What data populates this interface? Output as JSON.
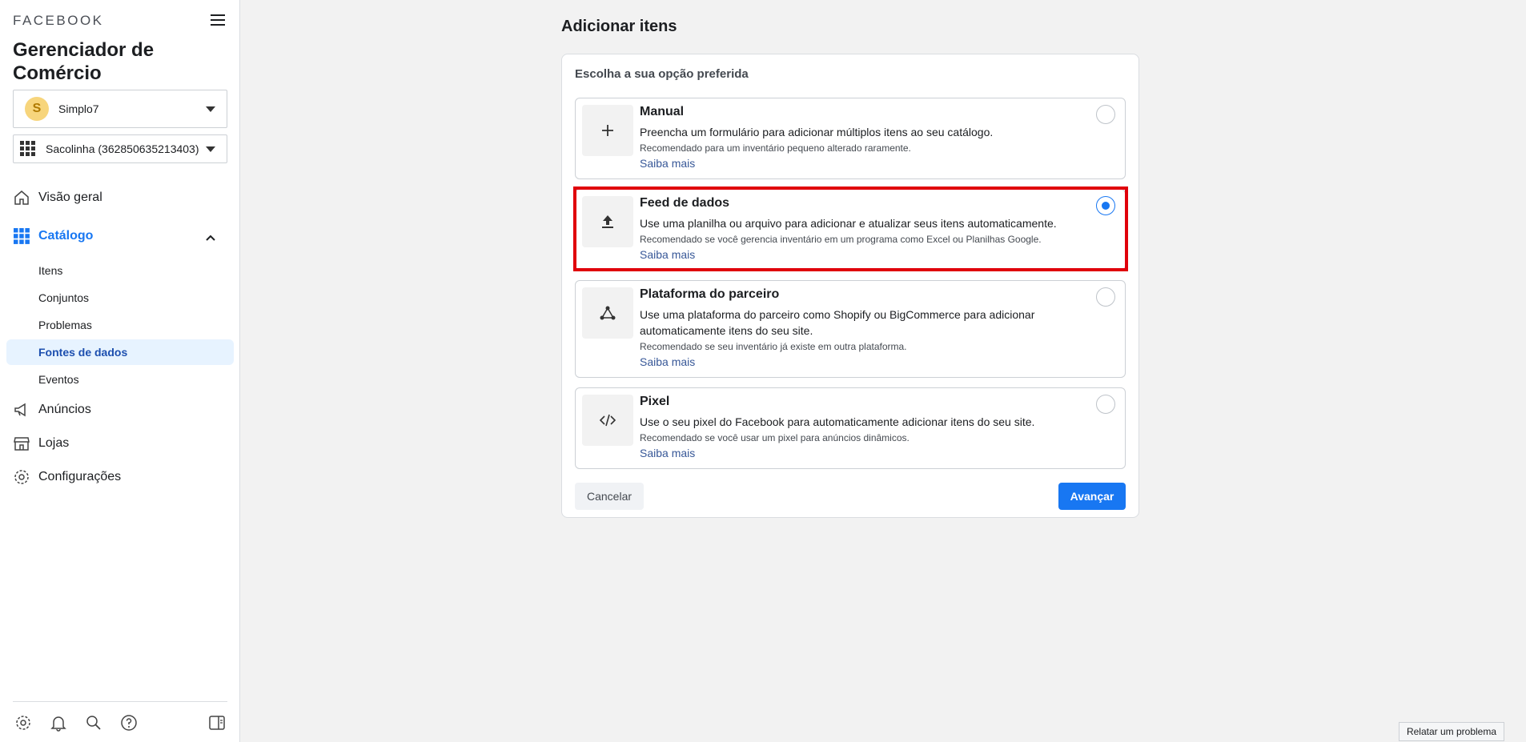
{
  "sidebar": {
    "brand": "FACEBOOK",
    "app_title": "Gerenciador de Comércio",
    "account": {
      "avatar_letter": "S",
      "name": "Simplo7"
    },
    "catalog_selector": "Sacolinha (362850635213403)",
    "nav": {
      "overview": "Visão geral",
      "catalog": "Catálogo",
      "ads": "Anúncios",
      "stores": "Lojas",
      "settings": "Configurações"
    },
    "catalog_sub": [
      "Itens",
      "Conjuntos",
      "Problemas",
      "Fontes de dados",
      "Eventos"
    ],
    "active_sub": "Fontes de dados"
  },
  "main": {
    "title": "Adicionar itens",
    "card_subtitle": "Escolha a sua opção preferida",
    "options": [
      {
        "title": "Manual",
        "desc": "Preencha um formulário para adicionar múltiplos itens ao seu catálogo.",
        "rec": "Recomendado para um inventário pequeno alterado raramente.",
        "link": "Saiba mais",
        "selected": false,
        "icon": "plus-icon"
      },
      {
        "title": "Feed de dados",
        "desc": "Use uma planilha ou arquivo para adicionar e atualizar seus itens automaticamente.",
        "rec": "Recomendado se você gerencia inventário em um programa como Excel ou Planilhas Google.",
        "link": "Saiba mais",
        "selected": true,
        "icon": "upload-icon"
      },
      {
        "title": "Plataforma do parceiro",
        "desc": "Use uma plataforma do parceiro como Shopify ou BigCommerce para adicionar automaticamente itens do seu site.",
        "rec": "Recomendado se seu inventário já existe em outra plataforma.",
        "link": "Saiba mais",
        "selected": false,
        "icon": "network-icon"
      },
      {
        "title": "Pixel",
        "desc": "Use o seu pixel do Facebook para automaticamente adicionar itens do seu site.",
        "rec": "Recomendado se você usar um pixel para anúncios dinâmicos.",
        "link": "Saiba mais",
        "selected": false,
        "icon": "code-icon"
      }
    ],
    "cancel": "Cancelar",
    "next": "Avançar"
  },
  "report_problem": "Relatar um problema",
  "colors": {
    "accent": "#1877f2",
    "highlight": "#e0000b"
  }
}
